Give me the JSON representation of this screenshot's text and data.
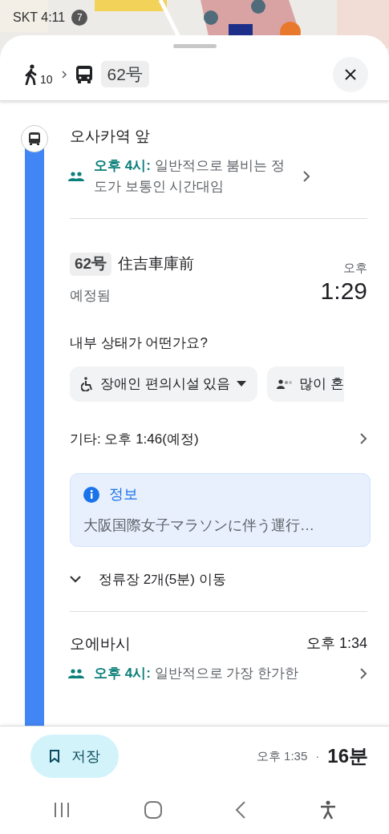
{
  "status_bar": {
    "carrier_time": "SKT 4:11",
    "notification_count": "7"
  },
  "header": {
    "steps": [
      {
        "kind": "walk",
        "label": "10"
      },
      {
        "kind": "bus",
        "label": "62号"
      }
    ]
  },
  "stop": {
    "name": "오사카역 앞",
    "crowd": "**오후 4시:** 일반적으로 붐비는 정도가 보통인 시간대임"
  },
  "departure": {
    "route": "62号",
    "destination": "住吉車庫前",
    "status": "예정됨",
    "time_period": "오후",
    "time": "1:29"
  },
  "question": "내부 상태가 어떤가요?",
  "chips": [
    {
      "kind": "accessible",
      "label": "장애인 편의시설 있음",
      "dropdown": true
    },
    {
      "kind": "crowded",
      "label": "많이 혼",
      "dropdown": false
    }
  ],
  "other": "기타: 오후 1:46(예정)",
  "notice": {
    "title": "정보",
    "text": "大阪国際女子マラソンに伴う運行…"
  },
  "stops_toggle": {
    "label": "정류장 2개(5분) 이동",
    "expanded": false
  },
  "next_stop": {
    "name": "오에바시",
    "time": "오후 1:34",
    "crowd": "**오후 4시:** 일반적으로 가장 한가한"
  },
  "footer": {
    "save": "저장",
    "arrival": "오후 1:35",
    "separator": "·",
    "duration": "16분"
  }
}
